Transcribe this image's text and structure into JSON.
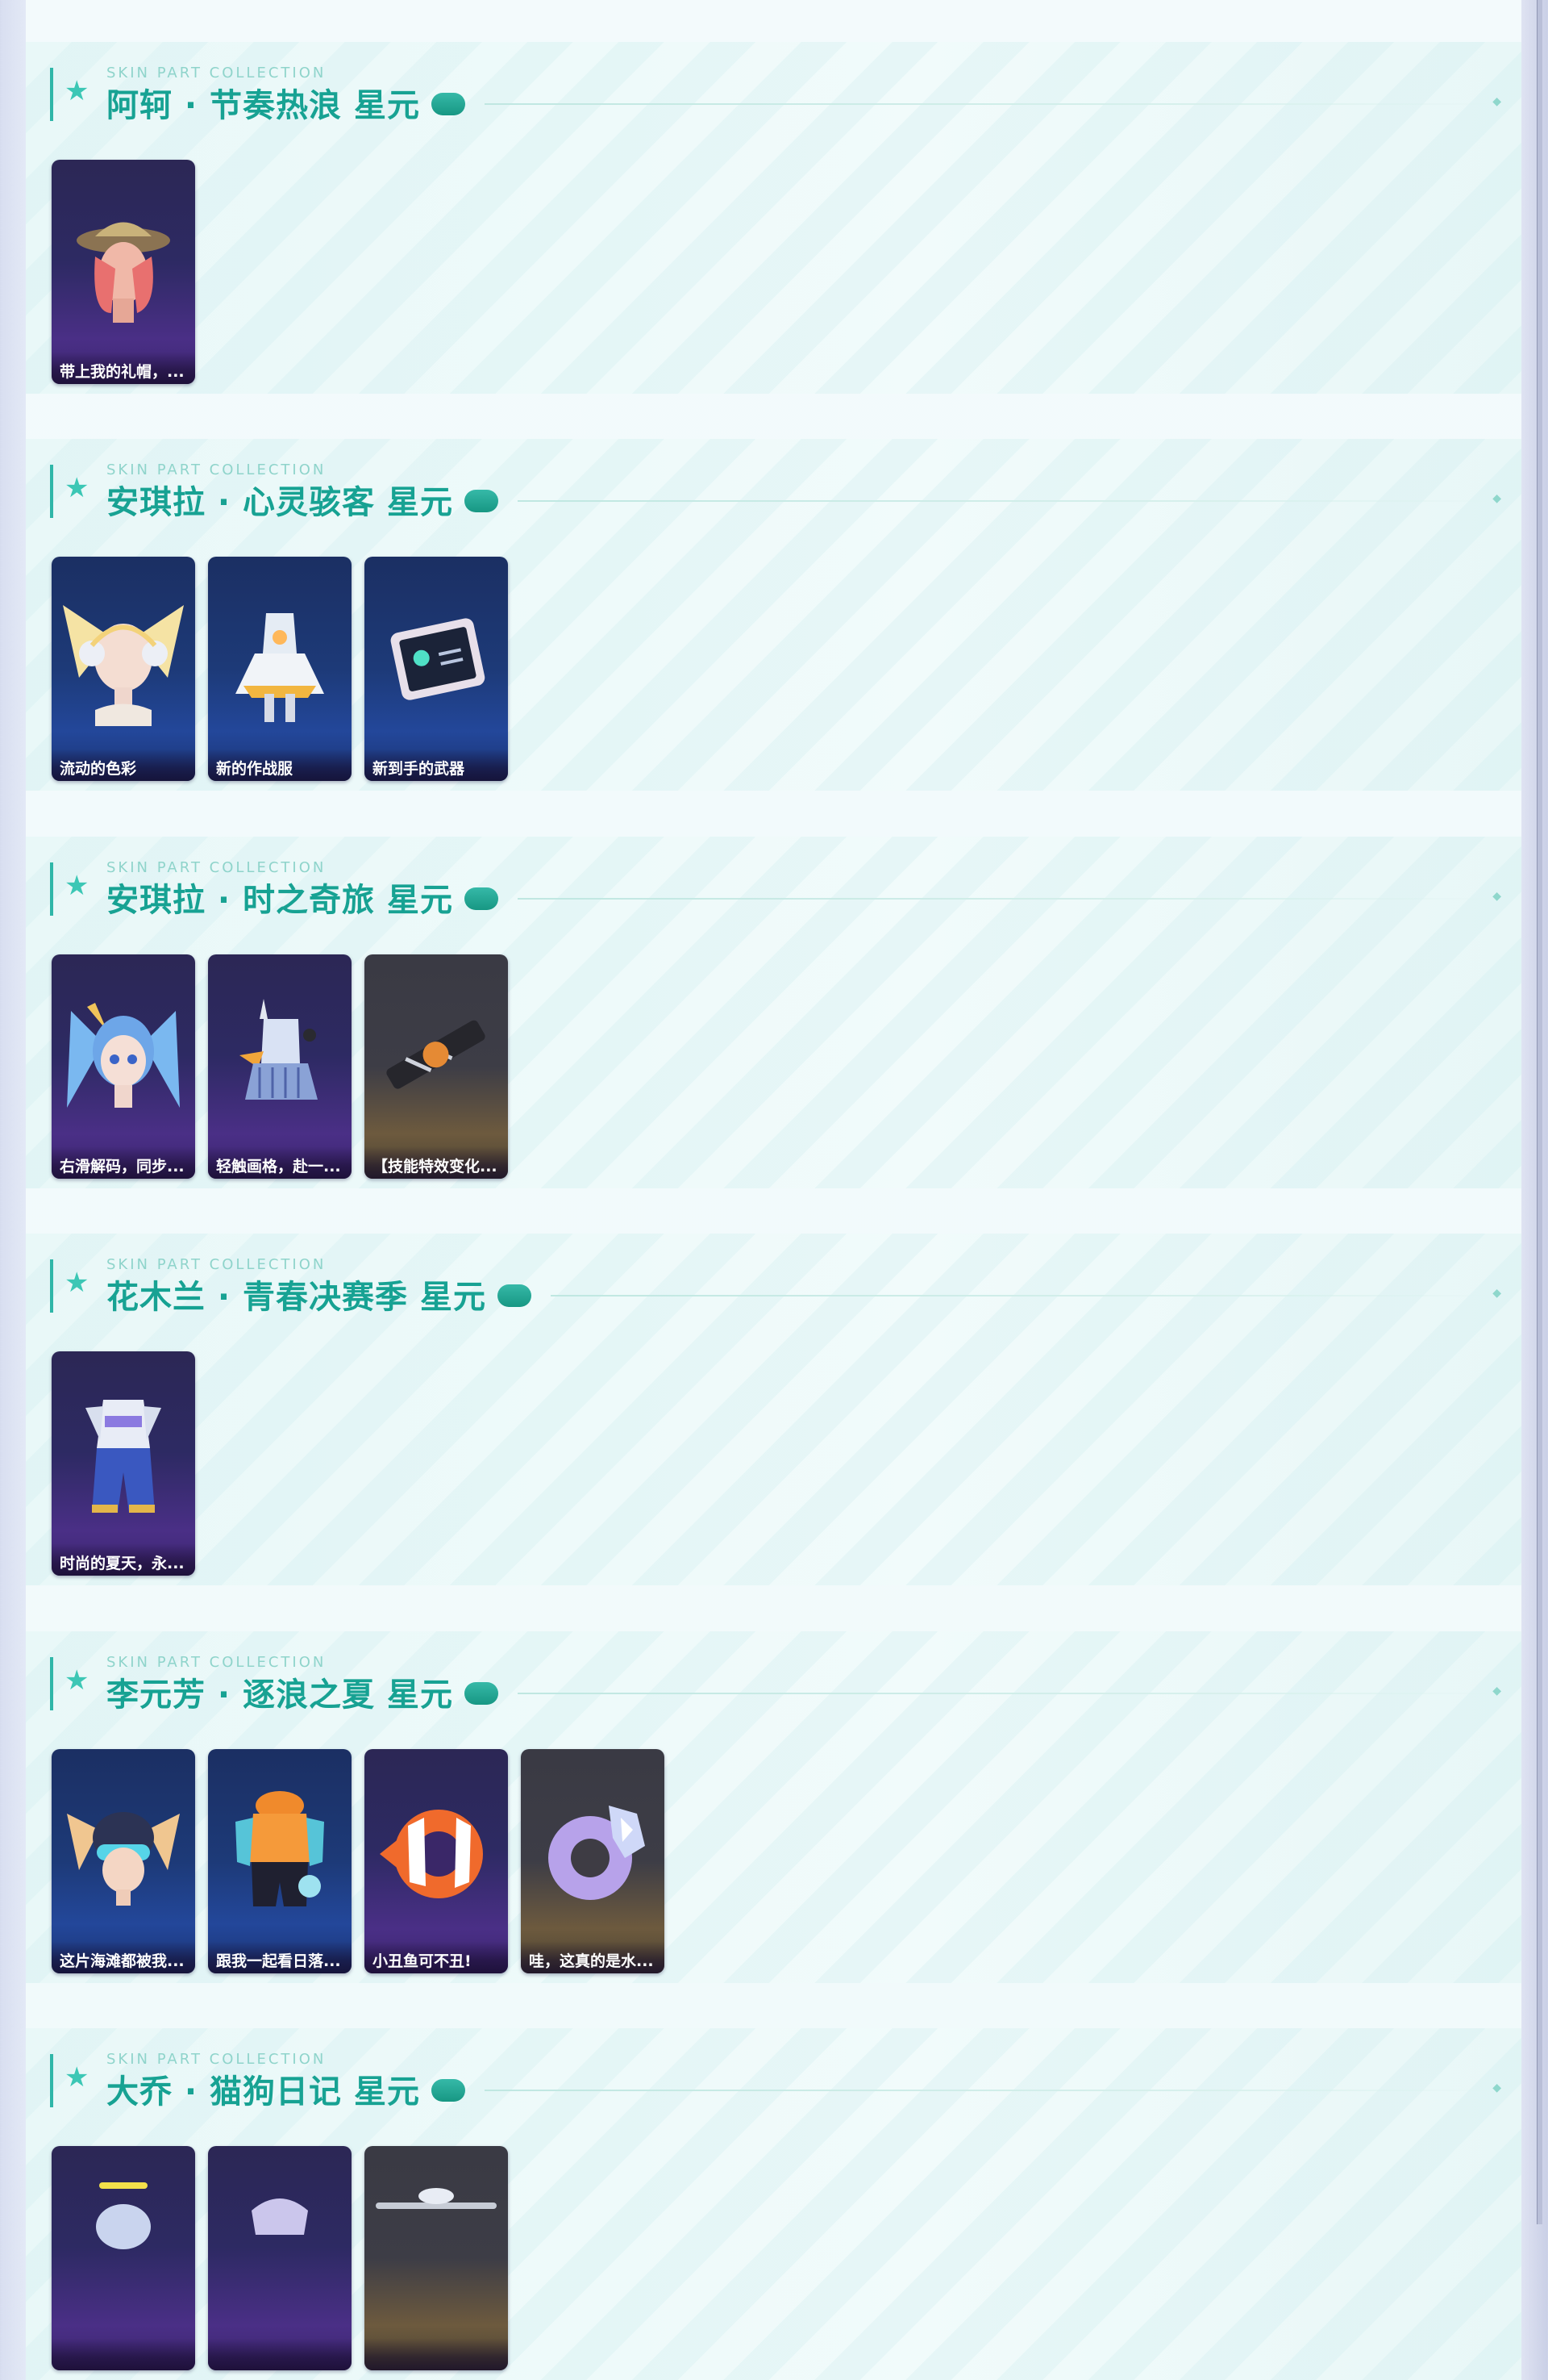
{
  "eyebrow": "SKIN PART COLLECTION",
  "colors": {
    "accent": "#17a293",
    "pill": "#1f9f8c",
    "card_purple": "#2d2a63",
    "card_blue": "#1d3a78",
    "card_dark": "#3d3d46"
  },
  "sections": [
    {
      "title": "阿轲 · 节奏热浪 星元",
      "cards": [
        {
          "caption": "带上我的礼帽，...",
          "icon": "character-head-hat-icon"
        }
      ]
    },
    {
      "title": "安琪拉 · 心灵骇客 星元",
      "cards": [
        {
          "caption": "流动的色彩",
          "icon": "character-head-headphones-icon"
        },
        {
          "caption": "新的作战服",
          "icon": "outfit-dress-icon"
        },
        {
          "caption": "新到手的武器",
          "icon": "tablet-weapon-icon"
        }
      ]
    },
    {
      "title": "安琪拉 · 时之奇旅 星元",
      "cards": [
        {
          "caption": "右滑解码，同步...",
          "icon": "character-head-twintail-icon"
        },
        {
          "caption": "轻触画格，赴一...",
          "icon": "outfit-skirt-icon"
        },
        {
          "caption": "【技能特效变化...",
          "icon": "weapon-blade-icon"
        }
      ]
    },
    {
      "title": "花木兰 · 青春决赛季 星元",
      "cards": [
        {
          "caption": "时尚的夏天，永...",
          "icon": "outfit-sport-icon"
        }
      ]
    },
    {
      "title": "李元芳 · 逐浪之夏 星元",
      "cards": [
        {
          "caption": "这片海滩都被我...",
          "icon": "character-head-goggles-icon"
        },
        {
          "caption": "跟我一起看日落...",
          "icon": "outfit-beach-icon"
        },
        {
          "caption": "小丑鱼可不丑!",
          "icon": "clownfish-ring-icon"
        },
        {
          "caption": "哇，这真的是水...",
          "icon": "crystal-ring-icon"
        }
      ]
    },
    {
      "title": "大乔 · 猫狗日记 星元",
      "cards": [
        {
          "caption": "",
          "icon": "character-head-cat-icon"
        },
        {
          "caption": "",
          "icon": "outfit-cat-icon"
        },
        {
          "caption": "",
          "icon": "weapon-staff-icon"
        }
      ]
    }
  ]
}
